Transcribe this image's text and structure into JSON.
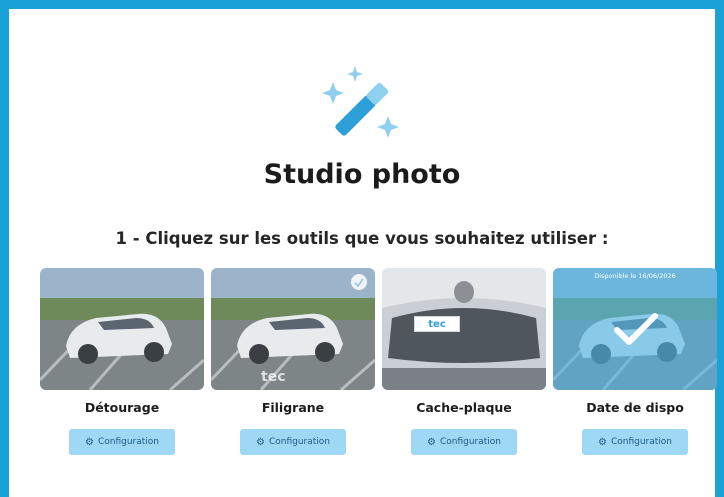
{
  "header": {
    "title": "Studio photo",
    "icon": "magic-wand-icon",
    "accent_color": "#1aa2d8"
  },
  "instruction": "1 - Cliquez sur les outils que vous souhaitez utiliser :",
  "tools": [
    {
      "label": "Détourage",
      "button_label": "Configuration",
      "selected": false
    },
    {
      "label": "Filigrane",
      "button_label": "Configuration",
      "selected": false,
      "watermark_text": "tec"
    },
    {
      "label": "Cache-plaque",
      "button_label": "Configuration",
      "selected": false,
      "plate_text": "tec"
    },
    {
      "label": "Date de dispo",
      "button_label": "Configuration",
      "selected": true,
      "overlay_text": "Disponible le 16/06/2026"
    }
  ],
  "colors": {
    "button_bg": "#9ed8f4",
    "button_text": "#1d5a86",
    "selected_overlay": "#4fb6e6"
  }
}
